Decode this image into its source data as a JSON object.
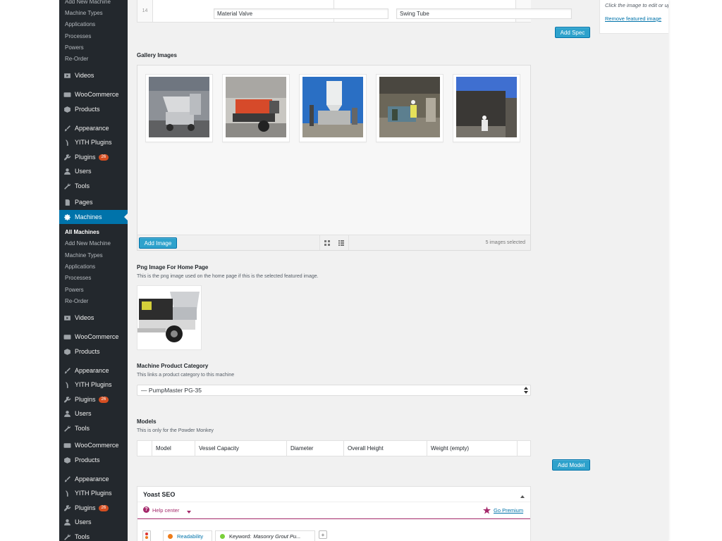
{
  "sidebar": {
    "top_submenu": [
      "Add New Machine",
      "Machine Types",
      "Applications",
      "Processes",
      "Powers",
      "Re-Order"
    ],
    "group1": [
      {
        "label": "Videos",
        "icon": "video-icon"
      },
      {
        "label": "WooCommerce",
        "icon": "woocommerce-icon"
      },
      {
        "label": "Products",
        "icon": "products-icon"
      },
      {
        "label": "Appearance",
        "icon": "brush-icon"
      },
      {
        "label": "YITH Plugins",
        "icon": "yith-icon"
      },
      {
        "label": "Plugins",
        "icon": "plugin-icon",
        "badge": "26"
      },
      {
        "label": "Users",
        "icon": "user-icon"
      },
      {
        "label": "Tools",
        "icon": "wrench-icon"
      },
      {
        "label": "Pages",
        "icon": "pages-icon"
      }
    ],
    "active": {
      "label": "Machines",
      "icon": "gear-icon"
    },
    "machines_submenu": [
      "All Machines",
      "Add New Machine",
      "Machine Types",
      "Applications",
      "Processes",
      "Powers",
      "Re-Order"
    ],
    "group2": [
      {
        "label": "Videos",
        "icon": "video-icon"
      },
      {
        "label": "WooCommerce",
        "icon": "woocommerce-icon"
      },
      {
        "label": "Products",
        "icon": "products-icon"
      },
      {
        "label": "Appearance",
        "icon": "brush-icon"
      },
      {
        "label": "YITH Plugins",
        "icon": "yith-icon"
      },
      {
        "label": "Plugins",
        "icon": "plugin-icon",
        "badge": "26"
      },
      {
        "label": "Users",
        "icon": "user-icon"
      },
      {
        "label": "Tools",
        "icon": "wrench-icon"
      }
    ],
    "group3": [
      {
        "label": "WooCommerce",
        "icon": "woocommerce-icon"
      },
      {
        "label": "Products",
        "icon": "products-icon"
      },
      {
        "label": "Appearance",
        "icon": "brush-icon"
      },
      {
        "label": "YITH Plugins",
        "icon": "yith-icon"
      },
      {
        "label": "Plugins",
        "icon": "plugin-icon",
        "badge": "26"
      },
      {
        "label": "Users",
        "icon": "user-icon"
      },
      {
        "label": "Tools",
        "icon": "wrench-icon"
      }
    ]
  },
  "specs": {
    "row_number": "14",
    "left_value": "Material Valve",
    "right_value": "Swing Tube",
    "add_button": "Add Spec"
  },
  "featured_image": {
    "hint": "Click the image to edit or update",
    "remove_link": "Remove featured image"
  },
  "gallery": {
    "title": "Gallery Images",
    "add_button": "Add Image",
    "count_text": "5 images selected",
    "images": [
      "mixer-machine-photo",
      "red-pump-photo",
      "silo-photo",
      "workers-photo",
      "wall-spray-photo"
    ]
  },
  "png_image": {
    "title": "Png Image For Home Page",
    "description": "This is the png image used on the home page if this is the selected featured image."
  },
  "category": {
    "title": "Machine Product Category",
    "description": "This links a product category to this machine",
    "selected": "— PumpMaster PG-35"
  },
  "models": {
    "title": "Models",
    "description": "This is only for the Powder Monkey",
    "columns": [
      "Model",
      "Vessel Capacity",
      "Diameter",
      "Overall Height",
      "Weight (empty)"
    ],
    "add_button": "Add Model"
  },
  "yoast": {
    "title": "Yoast SEO",
    "help_center": "Help center",
    "go_premium": "Go Premium",
    "readability_tab": "Readability",
    "keyword_label": "Keyword:",
    "keyword_value": "Masonry Grout Pu...",
    "add_tab": "+"
  },
  "colors": {
    "sidebar_bg": "#23282d",
    "active_bg": "#0073aa",
    "button_bg": "#2ea2cc",
    "badge": "#d54e21",
    "yoast_purple": "#a4286a",
    "link_blue": "#0073aa"
  }
}
